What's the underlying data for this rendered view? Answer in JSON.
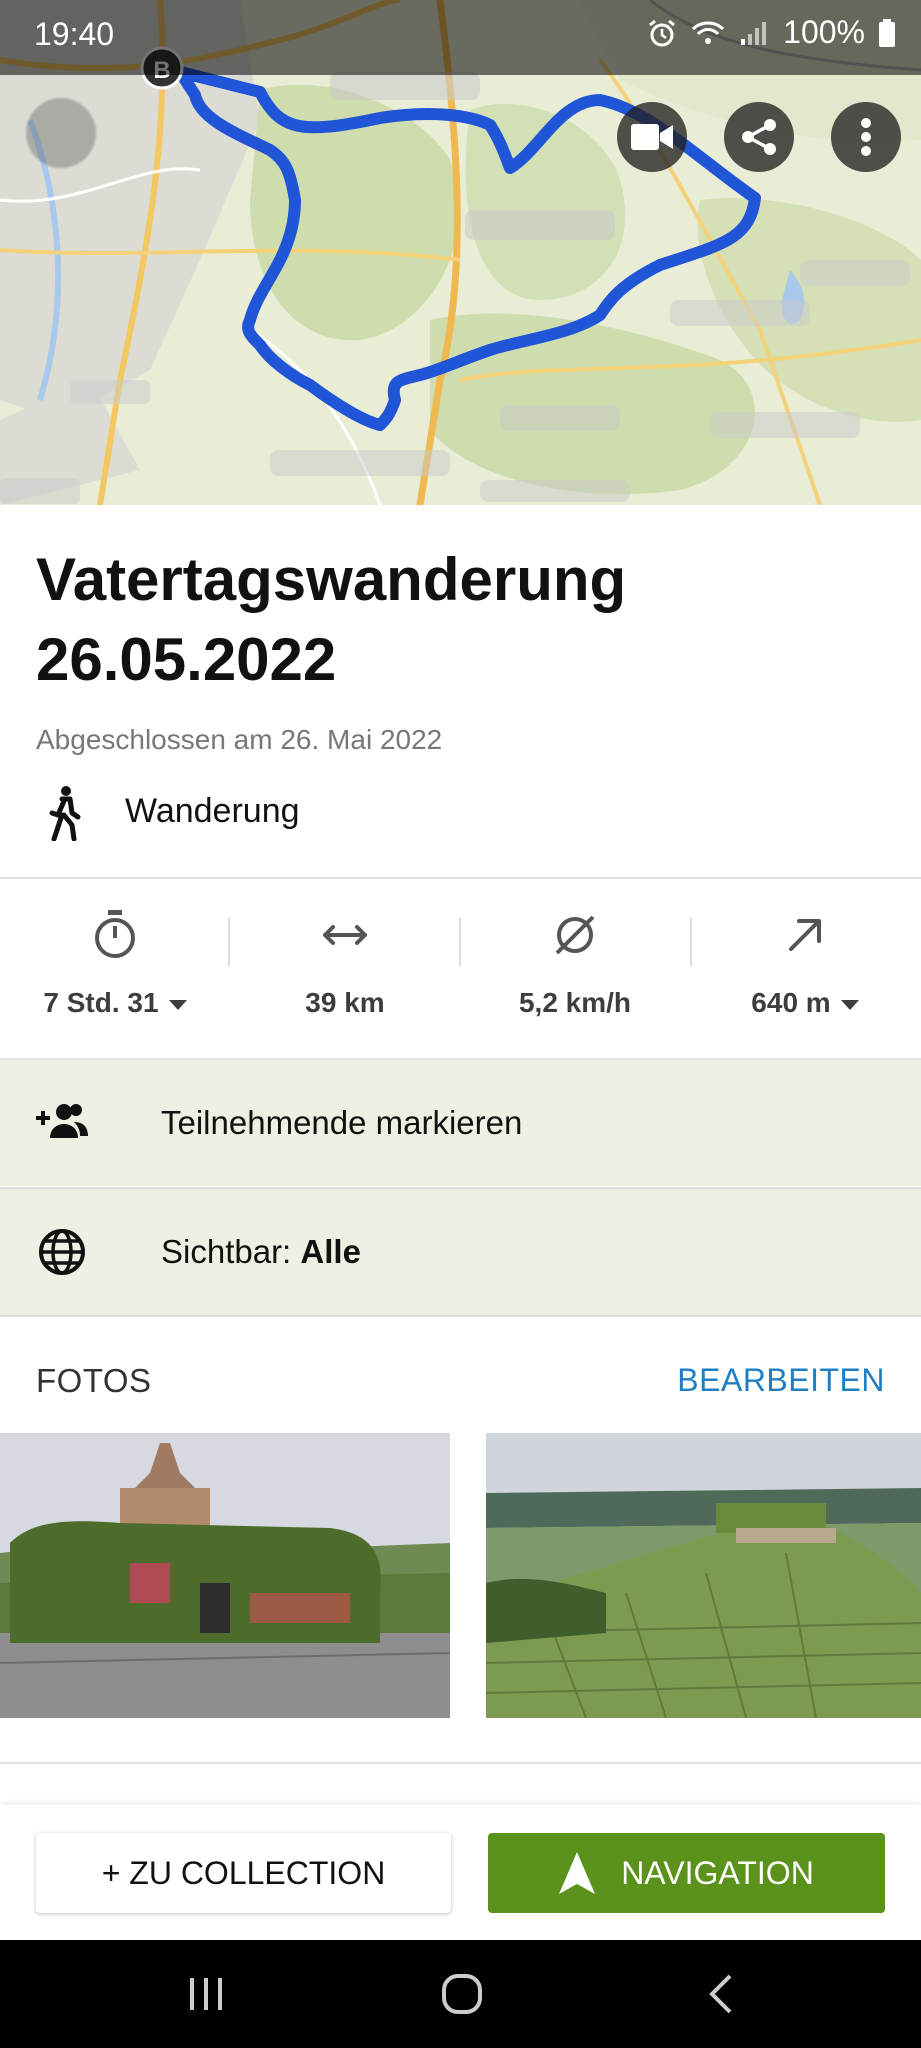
{
  "status_bar": {
    "time": "19:40",
    "battery": "100%"
  },
  "map": {
    "marker_label": "B",
    "buttons": [
      {
        "name": "video",
        "icon": "video-camera-icon"
      },
      {
        "name": "share",
        "icon": "share-icon"
      },
      {
        "name": "more",
        "icon": "more-vertical-icon"
      }
    ],
    "route_color": "#1f55d6"
  },
  "tour": {
    "title": "Vatertagswanderung 26.05.2022",
    "completed": "Abgeschlossen am 26. Mai 2022",
    "activity": "Wanderung"
  },
  "stats": {
    "duration": "7 Std. 31",
    "distance": "39 km",
    "speed": "5,2 km/h",
    "elevation": "640 m"
  },
  "actions": {
    "tag_participants": "Teilnehmende markieren",
    "visibility_label": "Sichtbar:",
    "visibility_value": "Alle"
  },
  "photos": {
    "title": "FOTOS",
    "edit": "BEARBEITEN"
  },
  "bottom_bar": {
    "collection": "+ ZU COLLECTION",
    "navigation": "NAVIGATION"
  },
  "colors": {
    "accent_green": "#5a921c",
    "link_blue": "#1f7fc4",
    "row_beige": "#f0efe3"
  }
}
